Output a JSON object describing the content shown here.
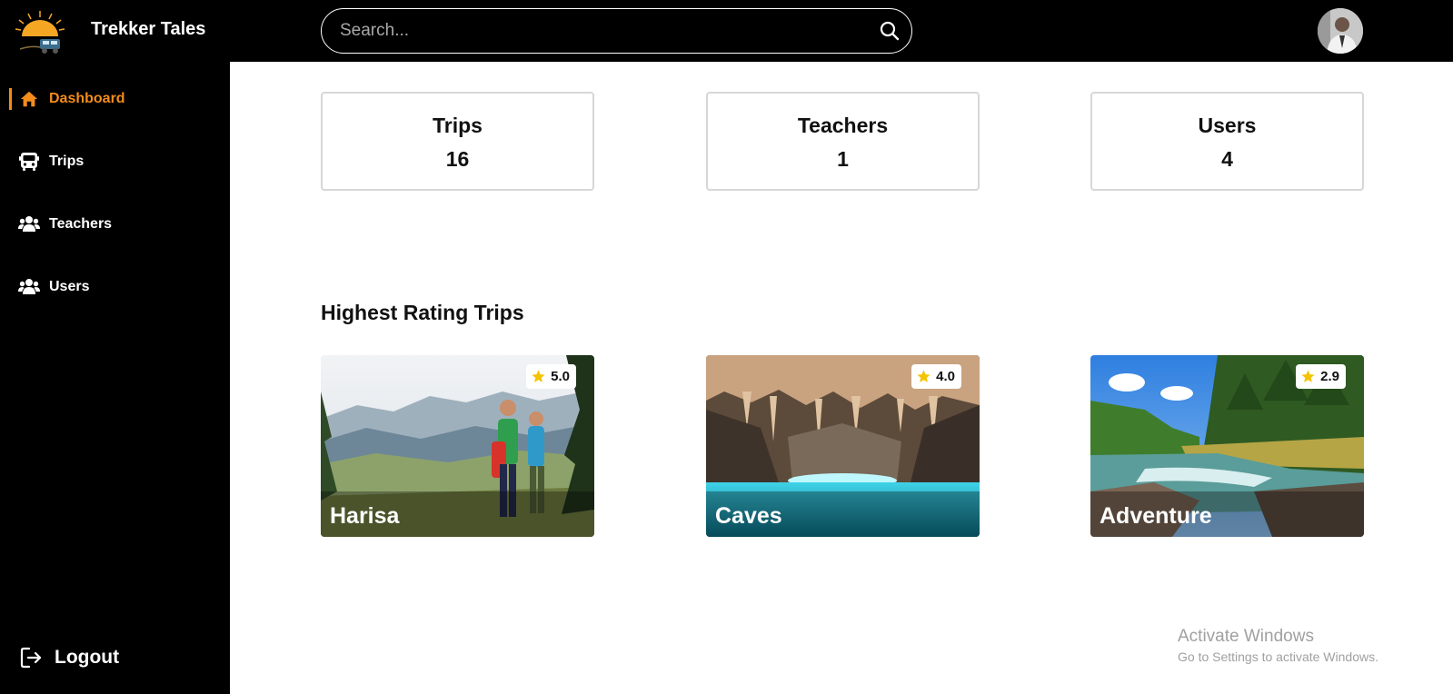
{
  "app": {
    "brand": "Trekker Tales"
  },
  "search": {
    "placeholder": "Search..."
  },
  "sidebar": {
    "items": [
      {
        "label": "Dashboard",
        "icon": "home-icon",
        "active": true
      },
      {
        "label": "Trips",
        "icon": "bus-icon"
      },
      {
        "label": "Teachers",
        "icon": "users-icon"
      },
      {
        "label": "Users",
        "icon": "users-icon"
      }
    ],
    "logout_label": "Logout"
  },
  "stats": [
    {
      "label": "Trips",
      "value": "16"
    },
    {
      "label": "Teachers",
      "value": "1"
    },
    {
      "label": "Users",
      "value": "4"
    }
  ],
  "section": {
    "title": "Highest Rating Trips"
  },
  "trips": [
    {
      "name": "Harisa",
      "rating": "5.0"
    },
    {
      "name": "Caves",
      "rating": "4.0"
    },
    {
      "name": "Adventure",
      "rating": "2.9"
    }
  ],
  "colors": {
    "accent": "#f28c1b",
    "star": "#f5c400",
    "background": "#000000"
  },
  "watermark": {
    "line1": "Activate Windows",
    "line2": "Go to Settings to activate Windows."
  }
}
